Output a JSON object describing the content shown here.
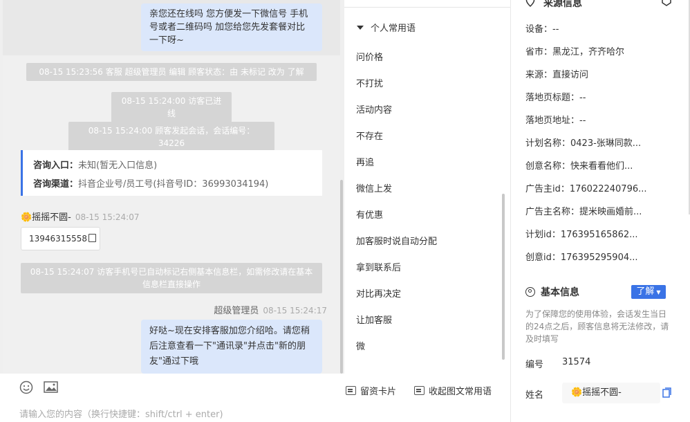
{
  "chat": {
    "top_bubble": "亲您还在线吗 您方便发一下微信号 手机号或者二维码吗 加您给您先发套餐对比一下呀~",
    "sys1": "08-15 15:23:56 客服 超级管理员 编辑 顾客状态：由 未标记 改为 了解",
    "sys2": "08-15 15:24:00 访客已进线",
    "sys3": "08-15 15:24:00 顾客发起会话，会话编号：34226",
    "card": {
      "entry_label": "咨询入口：",
      "entry_value": "未知(暂无入口信息)",
      "channel_label": "咨询渠道：",
      "channel_value": "抖音企业号/员工号(抖音号ID：36993034194)"
    },
    "visitor_name": "🌼摇摇不圆-",
    "visitor_time": "08-15 15:24:07",
    "visitor_phone": "13946315558",
    "sys4": "08-15 15:24:07 访客手机号已自动标记右侧基本信息栏，如需修改请在基本信息栏直接操作",
    "agent_name": "超级管理员",
    "agent_time": "08-15 15:24:17",
    "agent_bubble": "好哒~现在安排客服加您介绍哈。请您稍后注意查看一下\"通讯录\"并点击\"新的朋友\"通过下哦"
  },
  "input": {
    "placeholder": "请输入您的内容（换行快捷键：shift/ctrl + enter)",
    "card_btn": "留资卡片",
    "collapse_btn": "收起图文常用语"
  },
  "phrases": {
    "heading": "个人常用语",
    "items": [
      "问价格",
      "不打扰",
      "活动内容",
      "不存在",
      "再追",
      "微信上发",
      "有优惠",
      "加客服时说自动分配",
      "拿到联系后",
      "对比再决定",
      "让加客服",
      "微"
    ]
  },
  "info": {
    "source_title": "来源信息",
    "rows": [
      "设备：--",
      "省市：黑龙江，齐齐哈尔",
      "来源：直接访问",
      "落地页标题：--",
      "落地页地址：--",
      "计划名称：0423-张琳同款...",
      "创意名称：快来看看他们...",
      "广告主id：176022240796...",
      "广告主名称：提米映画婚前...",
      "计划id：176395165862...",
      "创意id：176395295904..."
    ],
    "basic_title": "基本信息",
    "status_label": "了解",
    "note": "为了保障您的使用体验，会话发生当日的24点之后，顾客信息将无法修改，请及时填写",
    "id_label": "编号",
    "id_value": "31574",
    "name_label": "姓名",
    "name_value": "🌼摇摇不圆-"
  },
  "colors": {
    "accent": "#3a73e6",
    "bubble": "#dbe7fb",
    "system": "#d5d5d5"
  }
}
